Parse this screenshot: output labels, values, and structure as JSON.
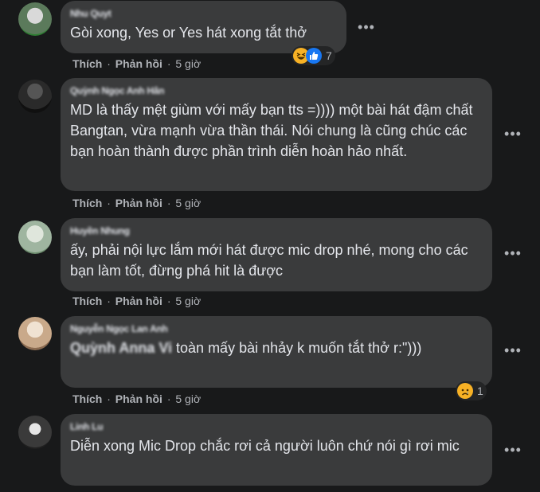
{
  "comments": [
    {
      "author": "Nhu Quyt",
      "text": "Gòi xong, Yes or Yes hát xong tắt thở",
      "actions": {
        "like": "Thích",
        "reply": "Phản hồi",
        "time": "5 giờ"
      },
      "reactions": {
        "icons": [
          "haha-icon",
          "like-icon"
        ],
        "count": "7"
      },
      "avatar_colors": [
        "#5b7a5b",
        "#d9d9d9",
        "#2e7d32"
      ]
    },
    {
      "author": "Quỳnh Ngọc Anh Hân",
      "text": "MD là thấy mệt giùm với mấy bạn tts =)))) một bài hát đậm chất Bangtan, vừa mạnh vừa thần thái. Nói chung là cũng chúc các bạn hoàn thành được phần trình diễn hoàn hảo nhất.",
      "actions": {
        "like": "Thích",
        "reply": "Phản hồi",
        "time": "5 giờ"
      },
      "avatar_colors": [
        "#2a2a2a",
        "#555555",
        "#101010"
      ]
    },
    {
      "author": "Huyền Nhung",
      "text": "ấy, phải nội lực lắm mới hát được mic drop nhé, mong cho các bạn làm tốt, đừng phá hit là được",
      "actions": {
        "like": "Thích",
        "reply": "Phản hồi",
        "time": "5 giờ"
      },
      "avatar_colors": [
        "#9fb5a0",
        "#dfe6dc",
        "#6f8f70"
      ]
    },
    {
      "author": "Nguyễn Ngọc Lan Anh",
      "mention": "Quỳnh Anna Vi",
      "text": "toàn mấy bài nhảy k muốn tắt thở r:\")))",
      "actions": {
        "like": "Thích",
        "reply": "Phản hồi",
        "time": "5 giờ"
      },
      "reactions": {
        "icons": [
          "sad-icon"
        ],
        "count": "1"
      },
      "avatar_colors": [
        "#c9a98a",
        "#f0e2d2",
        "#8a6a50"
      ]
    },
    {
      "author": "Linh Lu",
      "text": "Diễn xong Mic Drop chắc rơi cả người luôn chứ nói gì rơi mic",
      "avatar_colors": [
        "#3a3a3a",
        "#e6e6e6",
        "#202020"
      ]
    }
  ],
  "more_label": "•••"
}
